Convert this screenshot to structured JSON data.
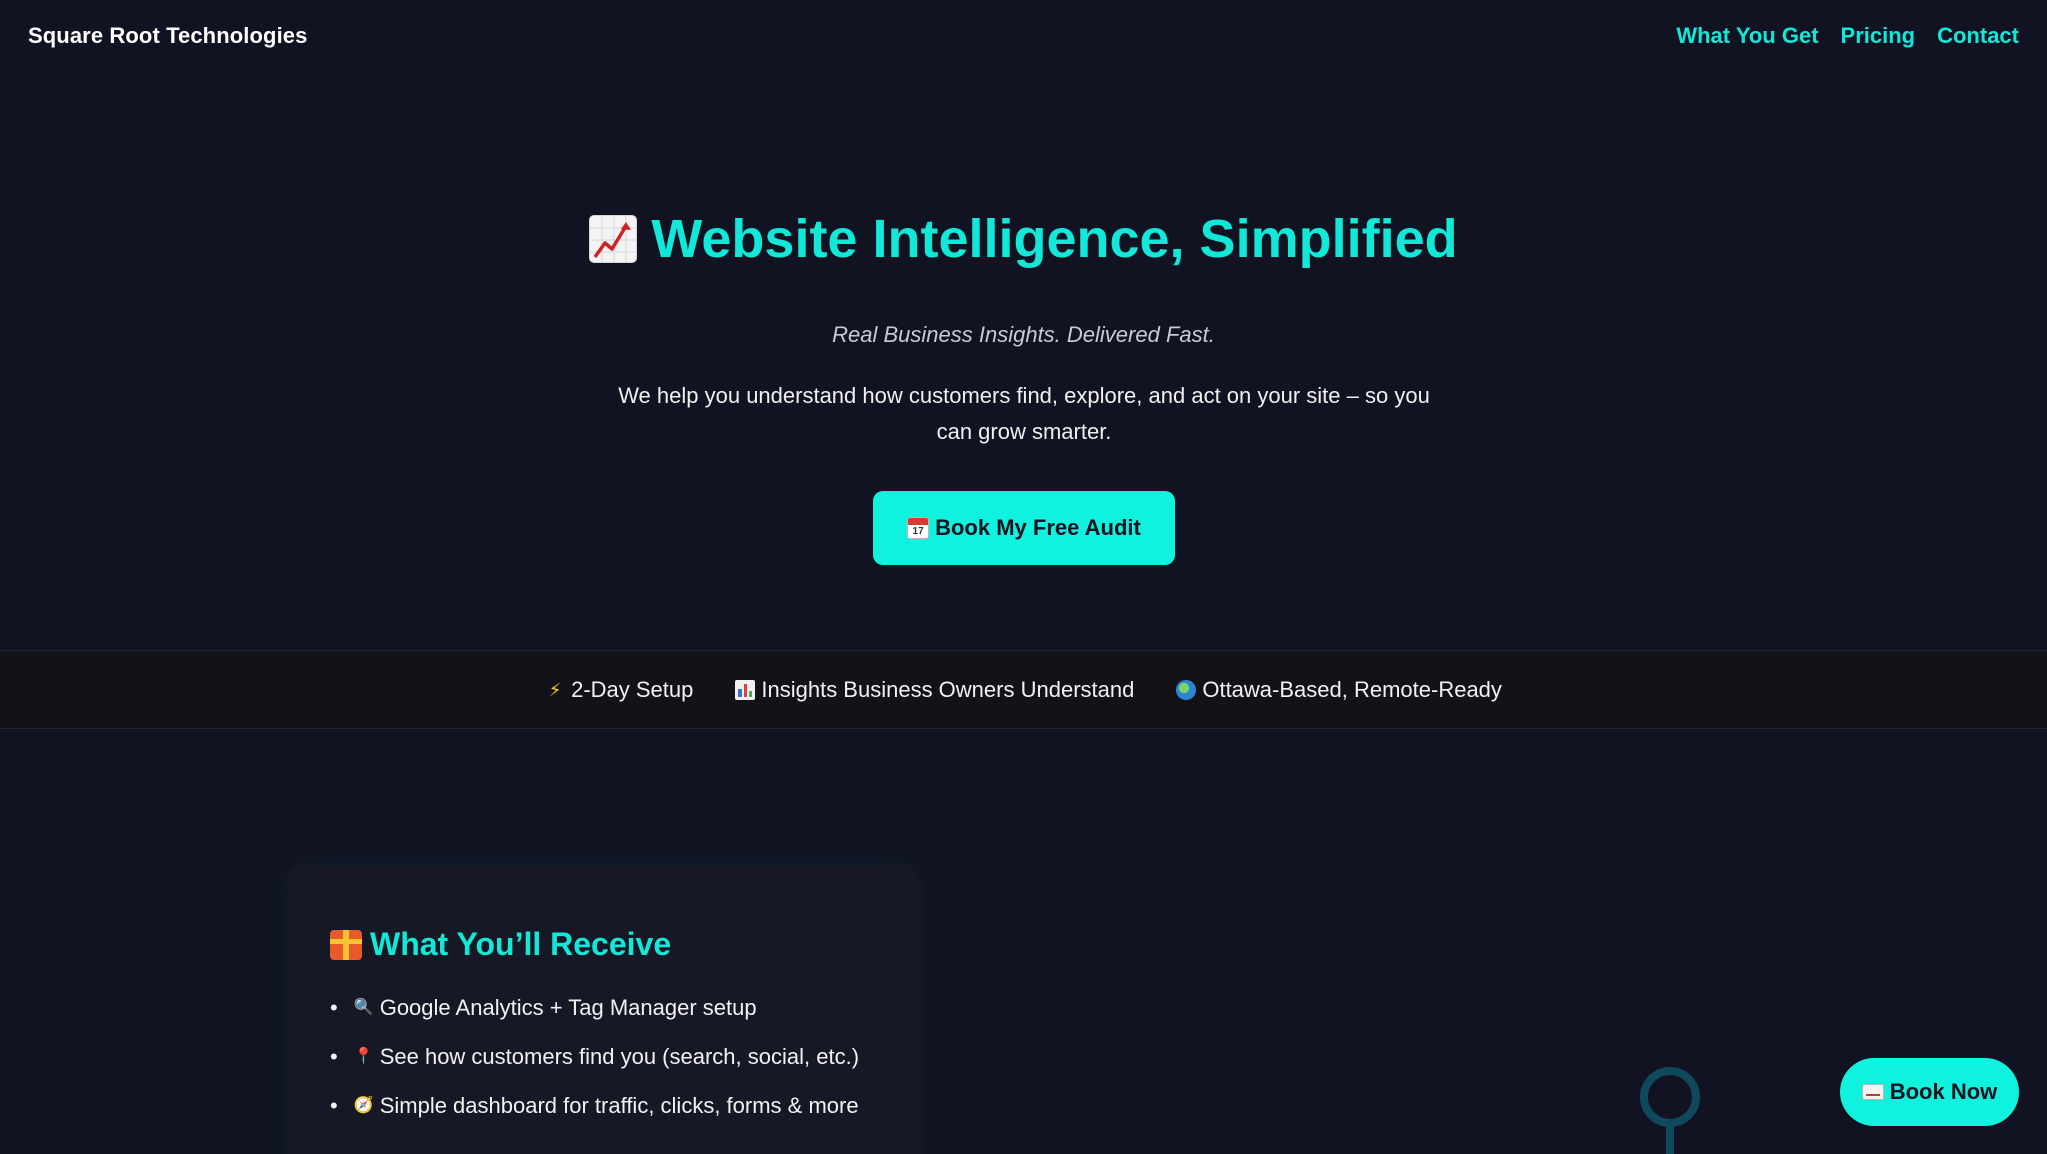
{
  "header": {
    "brand": "Square Root Technologies",
    "nav": [
      {
        "label": "What You Get"
      },
      {
        "label": "Pricing"
      },
      {
        "label": "Contact"
      }
    ]
  },
  "hero": {
    "title": "Website Intelligence, Simplified",
    "title_icon": "chart-increasing-icon",
    "tagline": "Real Business Insights. Delivered Fast.",
    "description": "We help you understand how customers find, explore, and act on your site – so you can grow smarter.",
    "cta_label": "Book My Free Audit",
    "cta_icon": "calendar-icon",
    "calendar_day": "17"
  },
  "features": [
    {
      "icon": "lightning-icon",
      "label": "2-Day Setup",
      "glyph": "⚡"
    },
    {
      "icon": "bar-chart-icon",
      "label": "Insights Business Owners Understand"
    },
    {
      "icon": "globe-icon",
      "label": "Ottawa-Based, Remote-Ready"
    }
  ],
  "receive": {
    "title": "What You’ll Receive",
    "title_icon": "gift-icon",
    "items": [
      {
        "icon": "magnifier-icon",
        "glyph": "🔍",
        "label": "Google Analytics + Tag Manager setup"
      },
      {
        "icon": "pin-icon",
        "glyph": "📍",
        "label": "See how customers find you (search, social, etc.)"
      },
      {
        "icon": "compass-icon",
        "glyph": "🧭",
        "label": "Simple dashboard for traffic, clicks, forms & more"
      }
    ]
  },
  "floating": {
    "label": "Book Now",
    "icon": "envelope-icon"
  },
  "colors": {
    "accent": "#0ff2de",
    "background": "#111322",
    "strip_background": "#121318"
  }
}
